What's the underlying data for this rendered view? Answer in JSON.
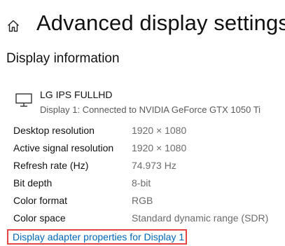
{
  "header": {
    "home_icon": "home-icon",
    "title": "Advanced display settings"
  },
  "section": {
    "title": "Display information"
  },
  "monitor": {
    "icon": "monitor-icon",
    "name": "LG IPS FULLHD",
    "description": "Display 1: Connected to NVIDIA GeForce GTX 1050 Ti"
  },
  "info_rows": [
    {
      "label": "Desktop resolution",
      "value": "1920 × 1080"
    },
    {
      "label": "Active signal resolution",
      "value": "1920 × 1080"
    },
    {
      "label": "Refresh rate (Hz)",
      "value": "74.973 Hz"
    },
    {
      "label": "Bit depth",
      "value": "8-bit"
    },
    {
      "label": "Color format",
      "value": "RGB"
    },
    {
      "label": "Color space",
      "value": "Standard dynamic range (SDR)"
    }
  ],
  "adapter_link": {
    "label": "Display adapter properties for Display 1"
  },
  "colors": {
    "link": "#0066b4",
    "highlight_border": "#e64545",
    "value_text": "#6b6b6b"
  }
}
